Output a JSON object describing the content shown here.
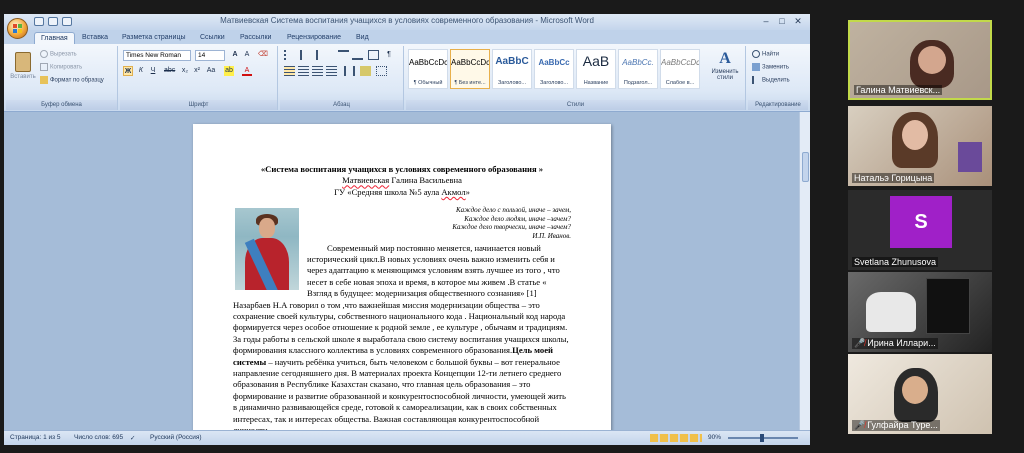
{
  "word": {
    "window_title": "Матвиевская Система воспитания учащихся в условиях современного образования - Microsoft Word",
    "tabs": [
      "Главная",
      "Вставка",
      "Разметка страницы",
      "Ссылки",
      "Рассылки",
      "Рецензирование",
      "Вид"
    ],
    "active_tab": "Главная",
    "clipboard": {
      "paste": "Вставить",
      "cut": "Вырезать",
      "copy": "Копировать",
      "format_painter": "Формат по образцу",
      "caption": "Буфер обмена"
    },
    "font": {
      "name": "Times New Roman",
      "size": "14",
      "caption": "Шрифт"
    },
    "paragraph_caption": "Абзац",
    "styles": {
      "caption": "Стили",
      "items": [
        {
          "preview": "AaBbCcDc",
          "name": "¶ Обычный"
        },
        {
          "preview": "AaBbCcDc",
          "name": "¶ Без инте..."
        },
        {
          "preview": "AaBbC",
          "name": "Заголово..."
        },
        {
          "preview": "AaBbCc",
          "name": "Заголово..."
        },
        {
          "preview": "AaB",
          "name": "Название"
        },
        {
          "preview": "AaBbCc.",
          "name": "Подзагол..."
        },
        {
          "preview": "AaBbCcDc",
          "name": "Слабое в..."
        }
      ],
      "change_styles": "Изменить стили"
    },
    "editing": {
      "caption": "Редактирование",
      "find": "Найти",
      "replace": "Заменить",
      "select": "Выделить"
    },
    "document": {
      "title": "«Система воспитания  учащихся в условиях современного образования »",
      "author_surname": "Матвиевская",
      "author_rest": " Галина Васильевна",
      "school_prefix": "ГУ «Средняя школа №5 аула ",
      "school_place": "Акмол",
      "school_suffix": "»",
      "epigraph": [
        "Каждое дело с пользой, иначе – зачем,",
        "Каждое дело людям, иначе –зачем?",
        "Каждое дело творчески, иначе –зачем?",
        "И.П. Иванов."
      ],
      "body_1": "Современный мир постоянно меняется, начинается новый исторический цикл.В  новых условиях очень важно изменить себя и через адаптацию к меняющимся условиям взять лучшее из того , что несет в себе новая эпоха и время, в которое мы живем .В статье « Взгляд в будущее: модернизация общественного сознания» [1] Назарбаев Н.А  говорил о том ,что важнейшая миссия модернизации общества – это сохранение своей культуры, собственного национального кода . Национальный код народа формируется через особое отношение к родной земле , ее культуре , обычаям и традициям. За годы работы в сельской школе я выработала свою систему воспитания учащихся школы, формирования классного коллектива в условиях современного образования.",
      "body_bold": "Цель моей системы",
      "body_2": " – научить ребёнка учиться, быть человеком с большой буквы – вот генеральное направление сегодняшнего дня. В материалах проекта Концепции 12-ти летнего среднего образования в Республике Казахстан сказано, что главная цель образования – это формирование и развитие образованной и конкурентоспособной личности, умеющей жить в динамично развивающейся среде, готовой к самореализации, как в своих собственных интересах, так и интересах общества. Важная составляющая конкурентоспособной личности –"
    },
    "status": {
      "page": "Страница: 1 из 5",
      "words": "Число слов: 695",
      "language": "Русский (Россия)",
      "zoom": "90%"
    }
  },
  "participants": [
    {
      "name": "Галина Матвиевск...",
      "active": true,
      "muted": false,
      "kind": "video"
    },
    {
      "name": "Натальэ Горицына",
      "active": false,
      "muted": false,
      "kind": "video"
    },
    {
      "name": "Svetlana Zhunusova",
      "active": false,
      "muted": false,
      "kind": "avatar",
      "initial": "S"
    },
    {
      "name": "Ирина Иллари...",
      "active": false,
      "muted": true,
      "kind": "video"
    },
    {
      "name": "Гулфайра Туре...",
      "active": false,
      "muted": true,
      "kind": "video"
    }
  ],
  "colors": {
    "active_speaker_border": "#c2d94a",
    "avatar_bg": "#a020c8",
    "muted_icon": "#e0352c"
  }
}
